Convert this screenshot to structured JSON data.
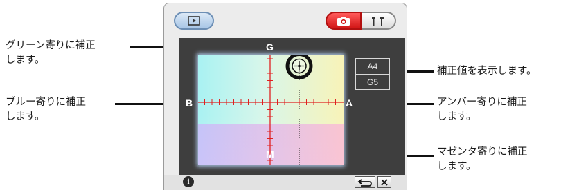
{
  "callouts": {
    "green": [
      "グリーン寄りに補正",
      "します。"
    ],
    "blue": [
      "ブルー寄りに補正",
      "します。"
    ],
    "display": [
      "補正値を表示します。"
    ],
    "amber": [
      "アンバー寄りに補正",
      "します。"
    ],
    "magenta": [
      "マゼンタ寄りに補正",
      "します。"
    ]
  },
  "tabs": {
    "playback_icon": "play-icon",
    "shooting_icon": "camera-icon",
    "settings_icon": "tools-icon"
  },
  "axis_labels": {
    "top": "G",
    "left": "B",
    "right": "A",
    "bottom": "M"
  },
  "values": {
    "amber_blue": "A4",
    "green_magenta": "G5"
  },
  "wb_shift": {
    "amber": 4,
    "green": 5
  },
  "footer": {
    "info_icon": "i",
    "reset_icon": "reset-icon",
    "close_icon": "close-icon"
  },
  "colors": {
    "axis_red": "#e02020",
    "tab_active": "#d11515",
    "tab_play": "#a8c6e6"
  }
}
